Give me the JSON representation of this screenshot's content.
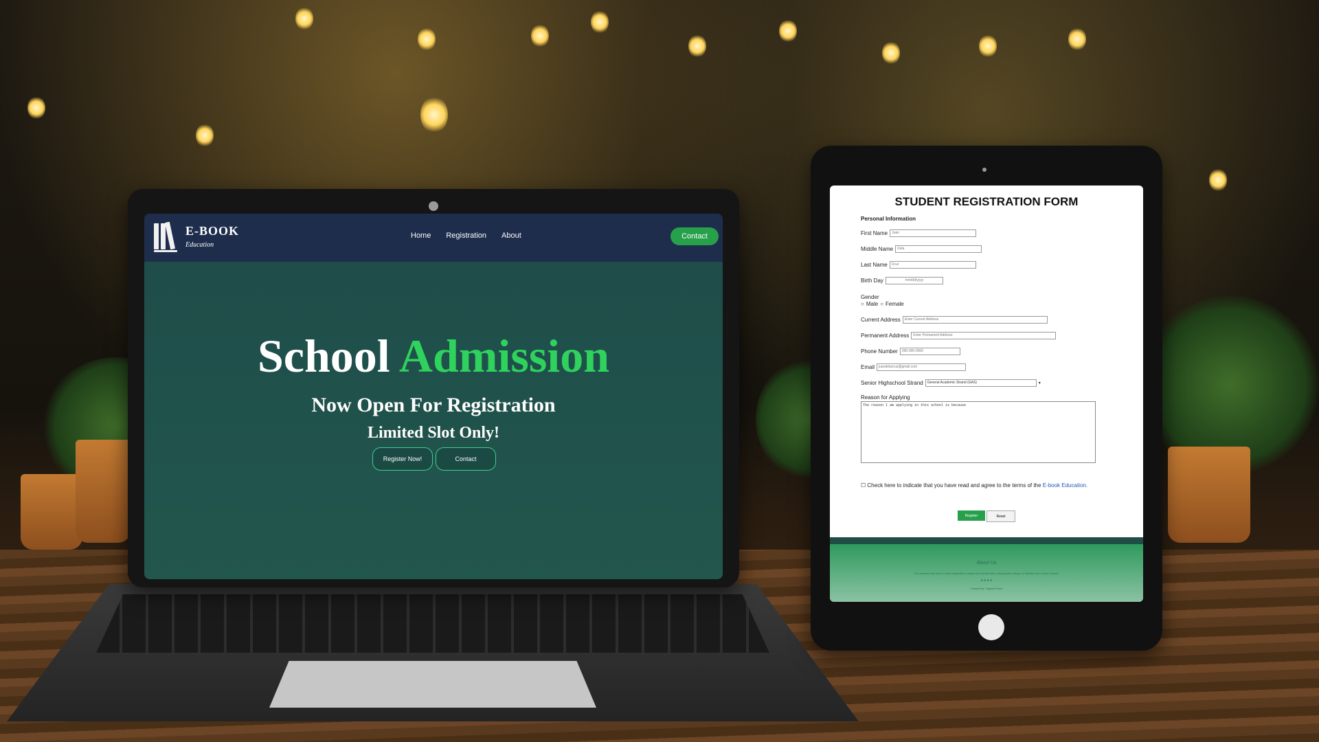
{
  "laptop_site": {
    "brand": {
      "name": "E-BOOK",
      "tagline": "Education"
    },
    "nav": {
      "links": [
        "Home",
        "Registration",
        "About"
      ],
      "contact_label": "Contact"
    },
    "hero": {
      "title_part1": "School",
      "title_part2": "Admission",
      "subtitle": "Now Open For Registration",
      "note": "Limited Slot Only!",
      "register_button": "Register Now!",
      "contact_button": "Contact"
    },
    "colors": {
      "accent": "#2fd25c",
      "nav_bg": "#1f2d4d",
      "hero_bg": "#22574d",
      "button_bg": "#27a04c"
    }
  },
  "tablet_form": {
    "title": "STUDENT REGISTRATION FORM",
    "section": "Personal Information",
    "fields": {
      "first_name": {
        "label": "First Name",
        "placeholder": "Juan"
      },
      "middle_name": {
        "label": "Middle Name",
        "placeholder": "Dela"
      },
      "last_name": {
        "label": "Last Name",
        "placeholder": "Cruz"
      },
      "birthday": {
        "label": "Birth Day",
        "placeholder": "mm/dd/yyyy"
      },
      "gender": {
        "label": "Gender",
        "options": [
          "Male",
          "Female"
        ]
      },
      "current_address": {
        "label": "Current Address",
        "placeholder": "Enter Current Address"
      },
      "permanent_address": {
        "label": "Permanent Address",
        "placeholder": "Enter Permanent Address"
      },
      "phone": {
        "label": "Phone Number",
        "placeholder": "000-000-0000"
      },
      "email": {
        "label": "Email",
        "placeholder": "juandelacruz@gmail.com"
      },
      "strand": {
        "label": "Senior Highschool Strand",
        "selected": "General Academic Strand (GAS)"
      },
      "reason": {
        "label": "Reason for Applying",
        "value": "The reason I am applying in this school is because"
      }
    },
    "agreement": {
      "text": "Check here to indicate that you have read and agree to the terms of the",
      "link": "E-book Education."
    },
    "buttons": {
      "register": "Register",
      "reset": "Reset"
    },
    "footer": {
      "about_title": "About Us",
      "about_text": "This website was built to make registration simple and contact-free, reducing the danger of infection from many viruses.",
      "icons": [
        "facebook-icon",
        "twitter-icon",
        "instagram-icon",
        "linkedin-icon"
      ],
      "credit": "Created by: Yugtala Perez"
    }
  }
}
